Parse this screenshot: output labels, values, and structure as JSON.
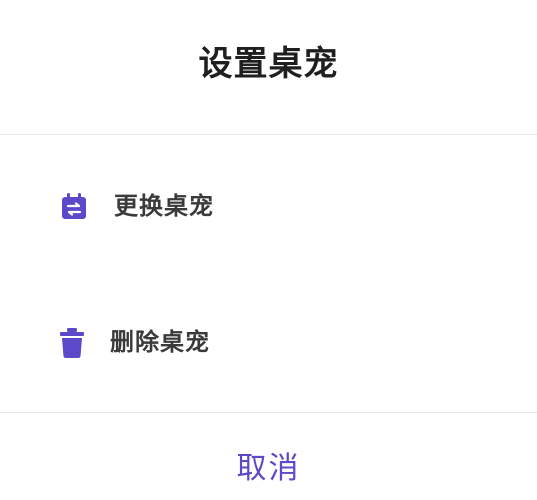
{
  "dialog": {
    "title": "设置桌宠",
    "options": [
      {
        "label": "更换桌宠",
        "icon": "swap-calendar-icon"
      },
      {
        "label": "删除桌宠",
        "icon": "trash-icon"
      }
    ],
    "cancel_label": "取消"
  },
  "colors": {
    "accent": "#5b49c9",
    "title_text": "#1f1f1f",
    "option_text": "#3a3a3a",
    "divider": "#e6e6e6",
    "background": "#ffffff"
  }
}
